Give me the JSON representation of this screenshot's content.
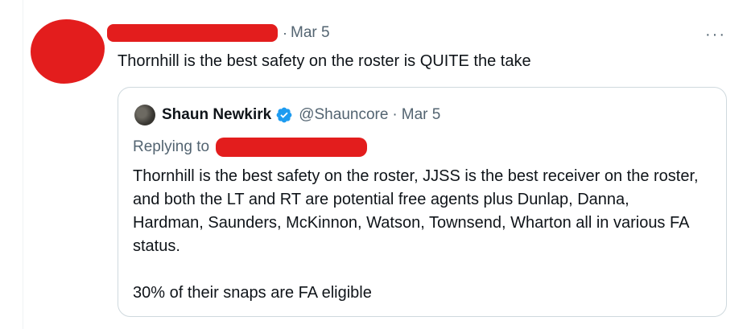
{
  "tweet": {
    "date": "Mar 5",
    "separator": "·",
    "text": "Thornhill is the best safety on the roster is QUITE the take",
    "more_label": "···"
  },
  "quoted_tweet": {
    "author_name": "Shaun Newkirk",
    "handle": "@Shauncore",
    "separator": "·",
    "date": "Mar 5",
    "replying_to_label": "Replying to",
    "body": "Thornhill is the best safety on the roster, JJSS is the best receiver on the roster, and both the LT and RT are potential free agents plus Dunlap, Danna, Hardman, Saunders, McKinnon, Watson, Townsend, Wharton all in various FA status.\n\n30% of their snaps are FA eligible",
    "verified_icon": "verified-badge-icon"
  },
  "colors": {
    "redaction": "#e31d1d",
    "muted_text": "#536471",
    "verified": "#1d9bf0",
    "border": "#cfd9de"
  }
}
